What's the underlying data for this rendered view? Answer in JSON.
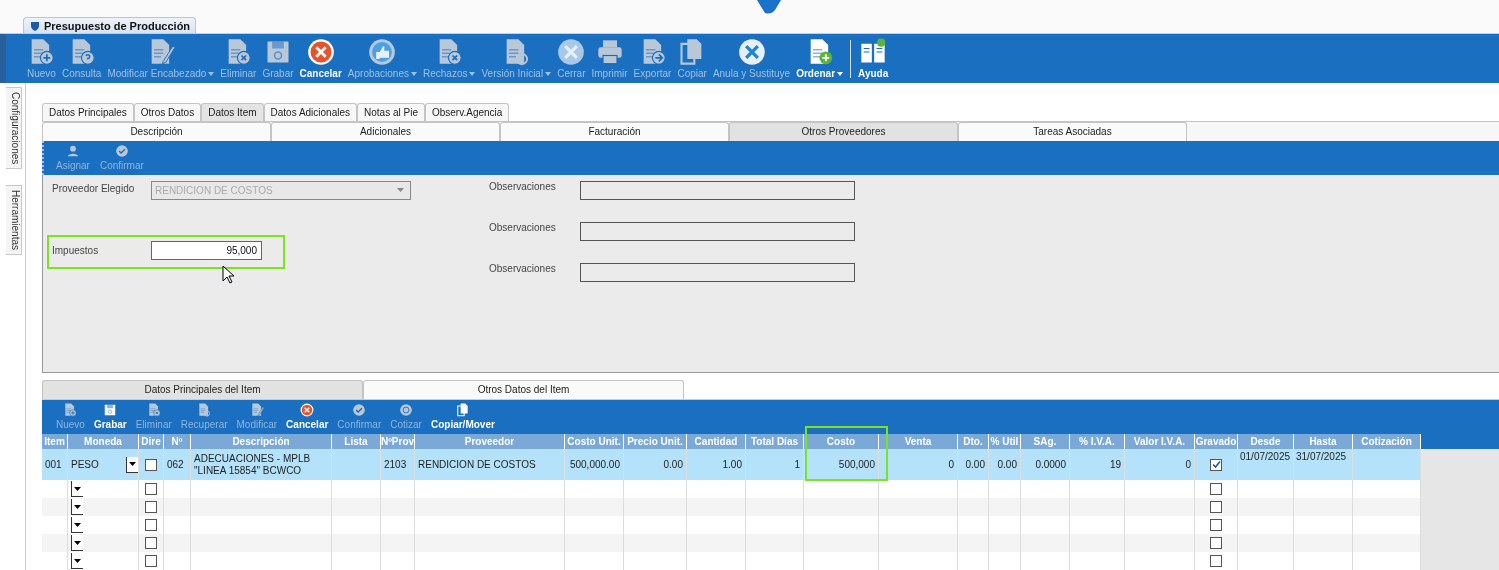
{
  "document_tab": {
    "title": "Presupuesto de Producción"
  },
  "toolbar": [
    {
      "label": "Nuevo",
      "disabled": true,
      "dropdown": false
    },
    {
      "label": "Consulta",
      "disabled": true,
      "dropdown": false
    },
    {
      "label": "Modificar Encabezado",
      "disabled": true,
      "dropdown": true
    },
    {
      "label": "Eliminar",
      "disabled": true,
      "dropdown": false
    },
    {
      "label": "Grabar",
      "disabled": true,
      "dropdown": false
    },
    {
      "label": "Cancelar",
      "disabled": false,
      "dropdown": false
    },
    {
      "label": "Aprobaciones",
      "disabled": true,
      "dropdown": true
    },
    {
      "label": "Rechazos",
      "disabled": true,
      "dropdown": true
    },
    {
      "label": "Versión Inicial",
      "disabled": true,
      "dropdown": true
    },
    {
      "label": "Cerrar",
      "disabled": true,
      "dropdown": false
    },
    {
      "label": "Imprimir",
      "disabled": true,
      "dropdown": false
    },
    {
      "label": "Exportar",
      "disabled": true,
      "dropdown": false
    },
    {
      "label": "Copiar",
      "disabled": true,
      "dropdown": false
    },
    {
      "label": "Anula y Sustituye",
      "disabled": true,
      "dropdown": false
    },
    {
      "label": "Ordenar",
      "disabled": false,
      "dropdown": true
    },
    {
      "label": "Ayuda",
      "disabled": false,
      "dropdown": false
    }
  ],
  "side_tabs": [
    {
      "label": "Configuraciones"
    },
    {
      "label": "Herramientas"
    }
  ],
  "tabs": [
    {
      "label": "Datos Principales",
      "selected": false
    },
    {
      "label": "Otros Datos",
      "selected": false
    },
    {
      "label": "Datos Item",
      "selected": true
    },
    {
      "label": "Datos Adicionales",
      "selected": false
    },
    {
      "label": "Notas al Pie",
      "selected": false
    },
    {
      "label": "Observ.Agencia",
      "selected": false
    }
  ],
  "sub_tabs": [
    {
      "label": "Descripción",
      "selected": false
    },
    {
      "label": "Adicionales",
      "selected": false
    },
    {
      "label": "Facturación",
      "selected": false
    },
    {
      "label": "Otros Proveedores",
      "selected": true
    },
    {
      "label": "Tareas Asociadas",
      "selected": false
    }
  ],
  "provider_toolbar": [
    {
      "label": "Asignar",
      "disabled": true
    },
    {
      "label": "Confirmar",
      "disabled": true
    }
  ],
  "form": {
    "provider_label": "Proveedor Elegido",
    "provider_value": "RENDICION DE COSTOS",
    "provider_disabled": true,
    "tax_label": "Impuestos",
    "tax_value": "95,000",
    "tax_highlighted": true,
    "observations": [
      {
        "label": "Observaciones"
      },
      {
        "label": "Observaciones"
      },
      {
        "label": "Observaciones"
      }
    ]
  },
  "item_tabs": [
    {
      "label": "Datos Principales del Item",
      "selected": true
    },
    {
      "label": "Otros Datos del Item",
      "selected": false
    }
  ],
  "item_toolbar": [
    {
      "label": "Nuevo",
      "disabled": true
    },
    {
      "label": "Grabar",
      "disabled": false
    },
    {
      "label": "Eliminar",
      "disabled": true
    },
    {
      "label": "Recuperar",
      "disabled": true
    },
    {
      "label": "Modificar",
      "disabled": true
    },
    {
      "label": "Cancelar",
      "disabled": false
    },
    {
      "label": "Confirmar",
      "disabled": true
    },
    {
      "label": "Cotizar",
      "disabled": true
    },
    {
      "label": "Copiar/Mover",
      "disabled": false
    }
  ],
  "table": {
    "columns": [
      {
        "label": "Item",
        "kind": "text",
        "highlighted": false
      },
      {
        "label": "Moneda",
        "kind": "dropdown",
        "highlighted": false
      },
      {
        "label": "Dire",
        "kind": "checkbox",
        "highlighted": false
      },
      {
        "label": "Nº",
        "kind": "text",
        "highlighted": false
      },
      {
        "label": "Descripción",
        "kind": "text",
        "highlighted": false
      },
      {
        "label": "Lista",
        "kind": "text",
        "highlighted": false
      },
      {
        "label": "NºProv",
        "kind": "text",
        "highlighted": false
      },
      {
        "label": "Proveedor",
        "kind": "text",
        "highlighted": false
      },
      {
        "label": "Costo Unit.",
        "kind": "number",
        "highlighted": false
      },
      {
        "label": "Precio Unit.",
        "kind": "number",
        "highlighted": false
      },
      {
        "label": "Cantidad",
        "kind": "number",
        "highlighted": false
      },
      {
        "label": "Total Días",
        "kind": "number",
        "highlighted": false
      },
      {
        "label": "Costo",
        "kind": "number",
        "highlighted": true
      },
      {
        "label": "Venta",
        "kind": "number",
        "highlighted": false
      },
      {
        "label": "Dto.",
        "kind": "number",
        "highlighted": false
      },
      {
        "label": "% Util",
        "kind": "number",
        "highlighted": false
      },
      {
        "label": "SAg.",
        "kind": "number",
        "highlighted": false
      },
      {
        "label": "% I.V.A.",
        "kind": "number",
        "highlighted": false
      },
      {
        "label": "Valor I.V.A.",
        "kind": "number",
        "highlighted": false
      },
      {
        "label": "Gravado",
        "kind": "checkbox",
        "highlighted": false
      },
      {
        "label": "Desde",
        "kind": "date",
        "highlighted": false
      },
      {
        "label": "Hasta",
        "kind": "date",
        "highlighted": false
      },
      {
        "label": "Cotización",
        "kind": "text",
        "highlighted": false
      }
    ],
    "rows": [
      {
        "selected": true,
        "cells": [
          "001",
          "PESO",
          false,
          "062",
          "ADECUACIONES - MPLB \"LINEA 15854\" BCWCO",
          null,
          "2103",
          "RENDICION DE COSTOS",
          "500,000.00",
          "0.00",
          "1.00",
          "1",
          "500,000",
          "0",
          "0.00",
          "0.00",
          "0.0000",
          "19",
          "0",
          true,
          "01/07/2025",
          "31/07/2025",
          null
        ]
      },
      {
        "selected": false,
        "cells": [
          null,
          null,
          false,
          null,
          null,
          null,
          null,
          null,
          null,
          null,
          null,
          null,
          null,
          null,
          null,
          null,
          null,
          null,
          null,
          false,
          null,
          null,
          null
        ]
      },
      {
        "selected": false,
        "cells": [
          null,
          null,
          false,
          null,
          null,
          null,
          null,
          null,
          null,
          null,
          null,
          null,
          null,
          null,
          null,
          null,
          null,
          null,
          null,
          false,
          null,
          null,
          null
        ]
      },
      {
        "selected": false,
        "cells": [
          null,
          null,
          false,
          null,
          null,
          null,
          null,
          null,
          null,
          null,
          null,
          null,
          null,
          null,
          null,
          null,
          null,
          null,
          null,
          false,
          null,
          null,
          null
        ]
      },
      {
        "selected": false,
        "cells": [
          null,
          null,
          false,
          null,
          null,
          null,
          null,
          null,
          null,
          null,
          null,
          null,
          null,
          null,
          null,
          null,
          null,
          null,
          null,
          false,
          null,
          null,
          null
        ]
      },
      {
        "selected": false,
        "cells": [
          null,
          null,
          false,
          null,
          null,
          null,
          null,
          null,
          null,
          null,
          null,
          null,
          null,
          null,
          null,
          null,
          null,
          null,
          null,
          false,
          null,
          null,
          null
        ]
      }
    ]
  }
}
